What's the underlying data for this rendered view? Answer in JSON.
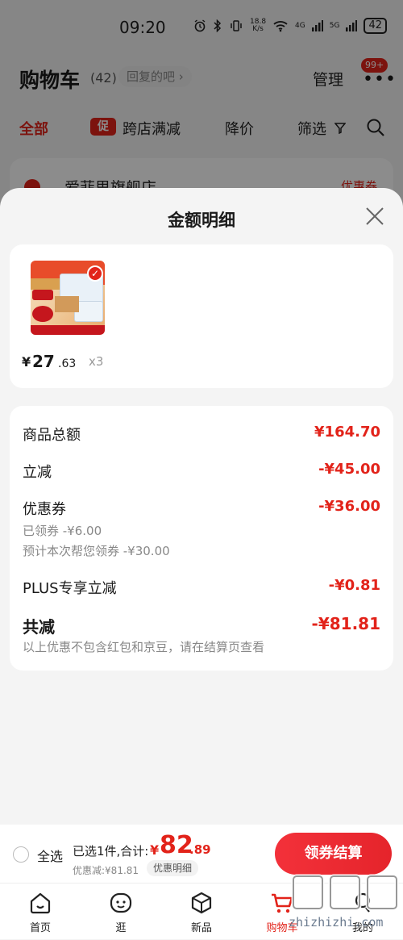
{
  "status_bar": {
    "time": "09:20",
    "speed_value": "18.8",
    "speed_unit": "K/s",
    "net1": "4G",
    "net2": "5G",
    "battery": "42"
  },
  "cart_header": {
    "title": "购物车",
    "count": "(42)",
    "hint": "回复的吧",
    "manage_label": "管理",
    "more_badge": "99+"
  },
  "cart_tabs": {
    "all": "全部",
    "promo_chip": "促",
    "promo": "跨店满减",
    "price_drop": "降价",
    "filter": "筛选"
  },
  "store": {
    "name": "爱菲思旗舰店",
    "coupon": "优惠券"
  },
  "sheet": {
    "title": "金额明细",
    "product": {
      "price_yen": "¥",
      "price_int": "27",
      "price_dec": ".63",
      "quantity": "x3"
    },
    "details": {
      "goods_total_label": "商品总额",
      "goods_total_value": "¥164.70",
      "instant_discount_label": "立减",
      "instant_discount_value": "-¥45.00",
      "coupon_label": "优惠券",
      "coupon_value": "-¥36.00",
      "coupon_claimed": "已领券 -¥6.00",
      "coupon_estimated": "预计本次帮您领券 -¥30.00",
      "plus_label": "PLUS专享立减",
      "plus_value": "-¥0.81",
      "total_label": "共减",
      "total_value": "-¥81.81",
      "total_note": "以上优惠不包含红包和京豆，请在结算页查看"
    }
  },
  "checkout": {
    "select_all": "全选",
    "selected_text": "已选1件,合计:",
    "sum_yen": "¥",
    "sum_int": "82",
    "sum_dec": ".89",
    "discount_text": "优惠减:¥81.81",
    "detail_link": "优惠明细",
    "checkout_button": "领券结算"
  },
  "tabbar": {
    "home": "首页",
    "browse": "逛",
    "new": "新品",
    "cart": "购物车",
    "me": "我的"
  },
  "watermark": "zhizhizhi.com",
  "colors": {
    "brand_red": "#e2231a",
    "overlay": "rgba(0,0,0,0.45)",
    "sheet_bg": "#f4f4f4"
  }
}
